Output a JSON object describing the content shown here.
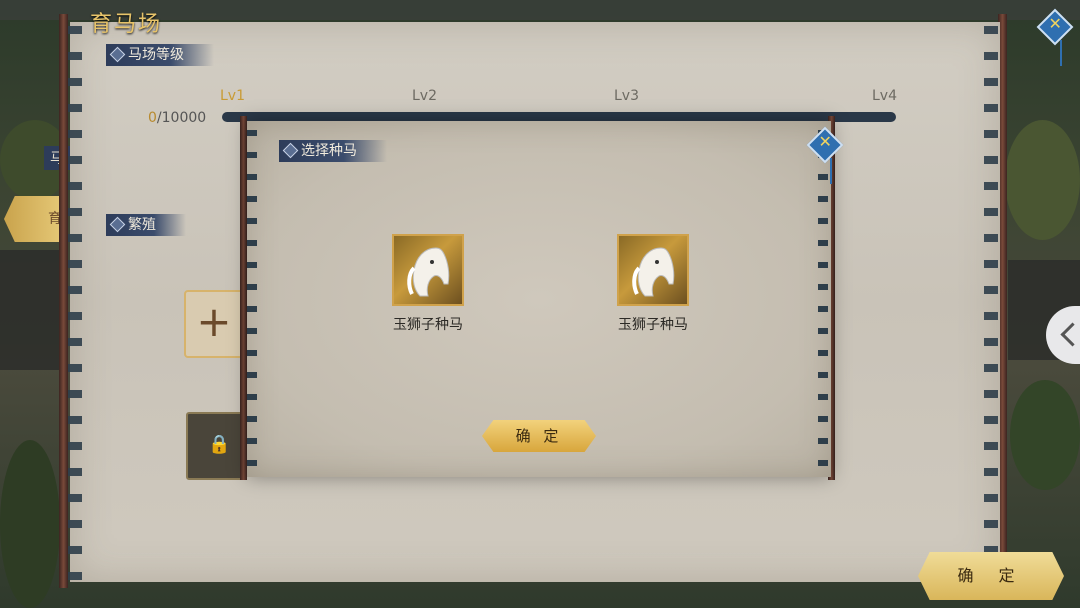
{
  "outer": {
    "title": "育马场",
    "level_section": "马场等级",
    "breed_section": "繁殖",
    "progress": {
      "current": "0",
      "rest": "/10000"
    },
    "levels": [
      "Lv1",
      "Lv2",
      "Lv3",
      "Lv4"
    ],
    "side_left_char": "育",
    "side_left_char2": "马",
    "confirm_label": "确  定",
    "plus": "+",
    "lock": "🔒"
  },
  "modal": {
    "title": "选择种马",
    "horses": [
      {
        "name": "玉狮子种马"
      },
      {
        "name": "玉狮子种马"
      }
    ],
    "confirm_label": "确 定"
  },
  "icons": [
    "close-pin-icon",
    "horse-portrait-icon",
    "lock-icon",
    "plus-icon",
    "chevron-left-icon"
  ]
}
